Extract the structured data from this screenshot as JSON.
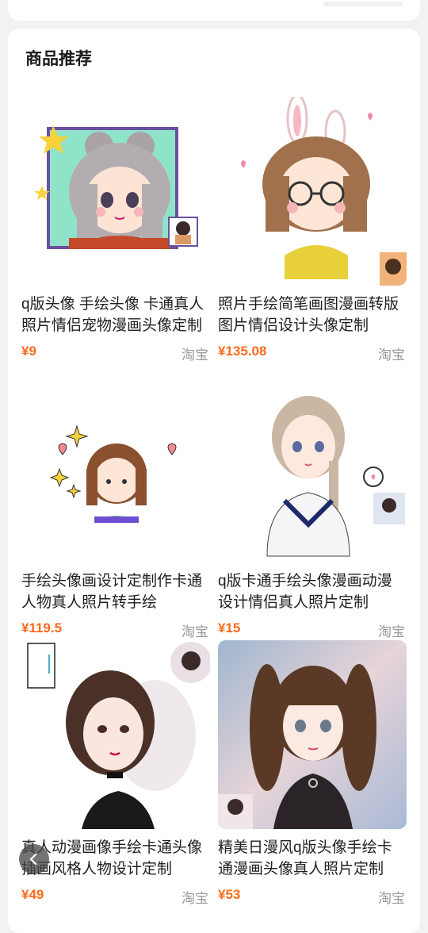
{
  "section": {
    "title": "商品推荐"
  },
  "colors": {
    "price": "#ff6a1a",
    "source": "#999999",
    "accent": "#ff6a1a"
  },
  "products": [
    {
      "title": "q版头像 手绘头像 卡通真人照片情侣宠物漫画头像定制",
      "price": "¥9",
      "source": "淘宝",
      "image": "cartoon-girl-buns-avatar"
    },
    {
      "title": "照片手绘简笔画图漫画转版图片情侣设计头像定制",
      "price": "¥135.08",
      "source": "淘宝",
      "image": "bunny-ear-glasses-girl"
    },
    {
      "title": "手绘头像画设计定制作卡通人物真人照片转手绘",
      "price": "¥119.5",
      "source": "淘宝",
      "image": "chibi-girl-sparkles"
    },
    {
      "title": "q版卡通手绘头像漫画动漫设计情侣真人照片定制",
      "price": "¥15",
      "source": "淘宝",
      "image": "sailor-uniform-girl"
    },
    {
      "title": "真人动漫画像手绘卡通头像插画风格人物设计定制",
      "price": "¥49",
      "source": "淘宝",
      "image": "realistic-portrait-girl"
    },
    {
      "title": "精美日漫风q版头像手绘卡通漫画头像真人照片定制",
      "price": "¥53",
      "source": "淘宝",
      "image": "twin-tail-anime-girl"
    }
  ]
}
